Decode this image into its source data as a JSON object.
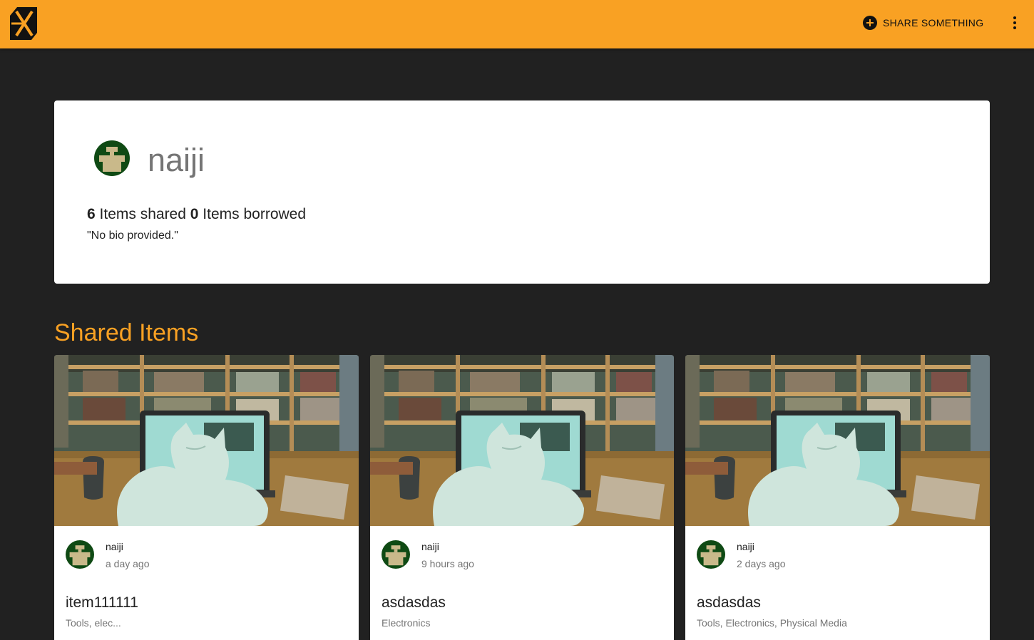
{
  "header": {
    "share_label": "SHARE SOMETHING",
    "accent": "#f9a123",
    "icons": {
      "logo": "boomtown-logo",
      "add": "add-circle-icon",
      "menu": "more-vert-icon"
    }
  },
  "profile": {
    "username": "naiji",
    "items_shared": "6",
    "items_shared_label": "Items shared",
    "items_borrowed": "0",
    "items_borrowed_label": "Items borrowed",
    "bio": "\"No bio provided.\""
  },
  "shared_section": {
    "title": "Shared Items",
    "items": [
      {
        "owner": "naiji",
        "posted": "a day ago",
        "title": "item111111",
        "tags": "Tools, elec..."
      },
      {
        "owner": "naiji",
        "posted": "9 hours ago",
        "title": "asdasdas",
        "tags": "Electronics"
      },
      {
        "owner": "naiji",
        "posted": "2 days ago",
        "title": "asdasdas",
        "tags": "Tools, Electronics, Physical Media"
      }
    ]
  }
}
